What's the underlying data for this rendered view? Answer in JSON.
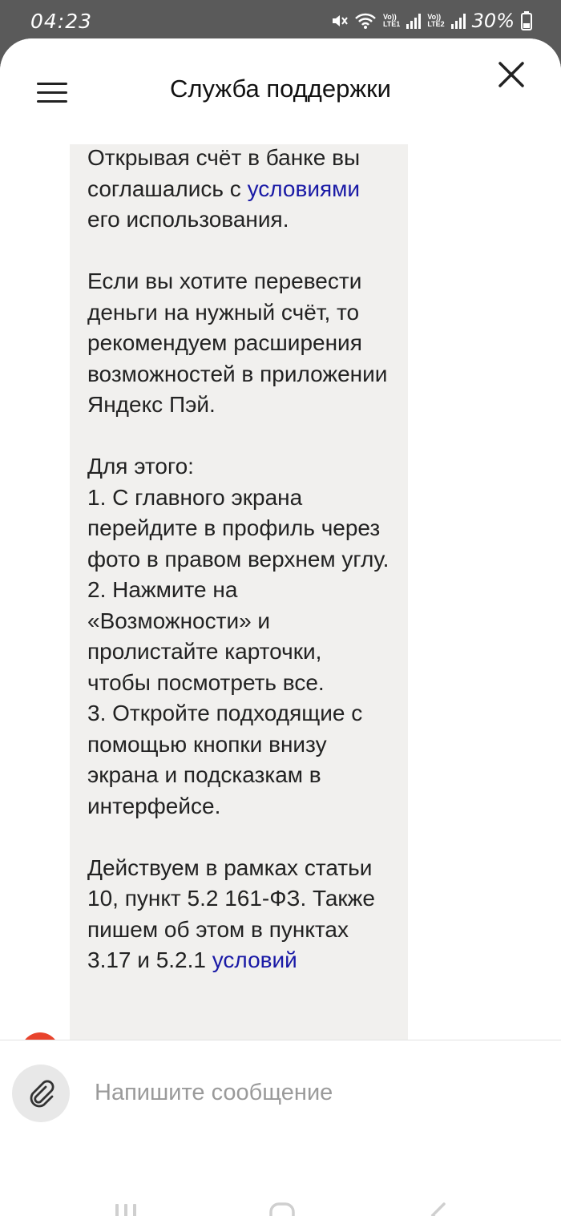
{
  "status_bar": {
    "time": "04:23",
    "sim1": "Vo))\nLTE1",
    "sim2": "Vo))\nLTE2",
    "battery": "30%"
  },
  "header": {
    "title": "Служба поддержки",
    "menu_icon": "hamburger-icon",
    "close_icon": "close-icon"
  },
  "message": {
    "p1_before_link": "Открывая счёт в банке вы соглашались с ",
    "p1_link": "условиями",
    "p1_after_link": " его использования.",
    "p2": "Если вы хотите перевести деньги на нужный счёт, то рекомендуем расширения возможностей в приложении Яндекс Пэй.",
    "p3": "Для этого:\n1. С главного экрана перейдите в профиль через фото в правом верхнем углу.\n2. Нажмите на «Возможности» и пролистайте карточки, чтобы посмотреть все.\n3. Откройте подходящие с помощью кнопки внизу экрана и подсказкам в интерфейсе.",
    "p4_before_link": "Действуем в рамках статьи 10, пункт 5.2 161-ФЗ. Также пишем об этом в пунктах 3.17 и 5.2.1 ",
    "p4_link": "условий"
  },
  "composer": {
    "placeholder": "Напишите сообщение",
    "attach_icon": "paperclip-icon"
  },
  "colors": {
    "link": "#1a1aa6",
    "bubble_bg": "#f1f0ee",
    "avatar": "#e8432c"
  }
}
